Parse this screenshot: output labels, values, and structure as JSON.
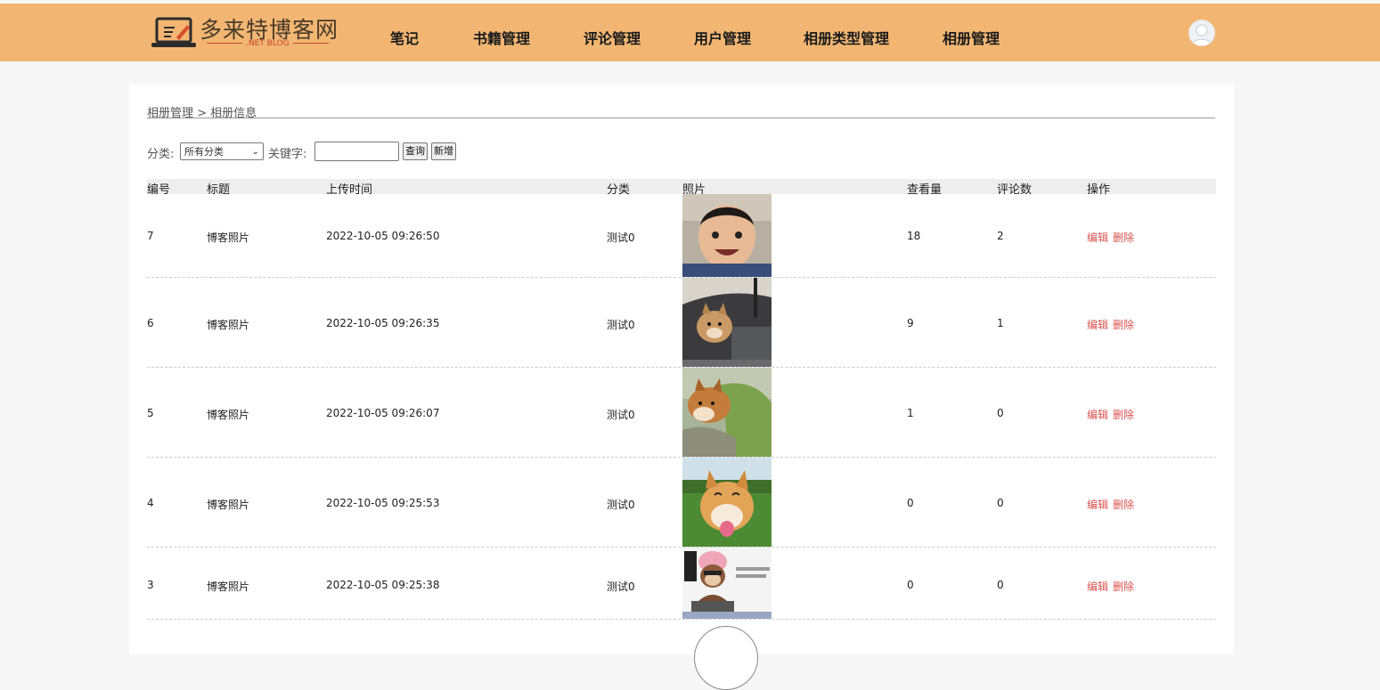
{
  "header": {
    "logo_title": "多来特博客网",
    "logo_sub": ".NET BLOG",
    "nav": [
      "笔记",
      "书籍管理",
      "评论管理",
      "用户管理",
      "相册类型管理",
      "相册管理"
    ]
  },
  "breadcrumb": "相册管理 > 相册信息",
  "filter": {
    "category_label": "分类:",
    "category_value": "所有分类",
    "keyword_label": "关键字:",
    "keyword_value": "",
    "search_button": "查询",
    "add_button": "新增"
  },
  "table": {
    "headers": [
      "编号",
      "标题",
      "上传时间",
      "分类",
      "照片",
      "查看量",
      "评论数",
      "操作"
    ],
    "rows": [
      {
        "id": "7",
        "title": "博客照片",
        "time": "2022-10-05 09:26:50",
        "category": "测试0",
        "photo": "baby",
        "views": "18",
        "comments": "2"
      },
      {
        "id": "6",
        "title": "博客照片",
        "time": "2022-10-05 09:26:35",
        "category": "测试0",
        "photo": "dog-window",
        "views": "9",
        "comments": "1"
      },
      {
        "id": "5",
        "title": "博客照片",
        "time": "2022-10-05 09:26:07",
        "category": "测试0",
        "photo": "dog-sofa",
        "views": "1",
        "comments": "0"
      },
      {
        "id": "4",
        "title": "博客照片",
        "time": "2022-10-05 09:25:53",
        "category": "测试0",
        "photo": "dog-grass",
        "views": "0",
        "comments": "0"
      },
      {
        "id": "3",
        "title": "博客照片",
        "time": "2022-10-05 09:25:38",
        "category": "测试0",
        "photo": "monkey-programmer",
        "views": "0",
        "comments": "0"
      }
    ],
    "edit_label": "编辑",
    "delete_label": "删除"
  }
}
